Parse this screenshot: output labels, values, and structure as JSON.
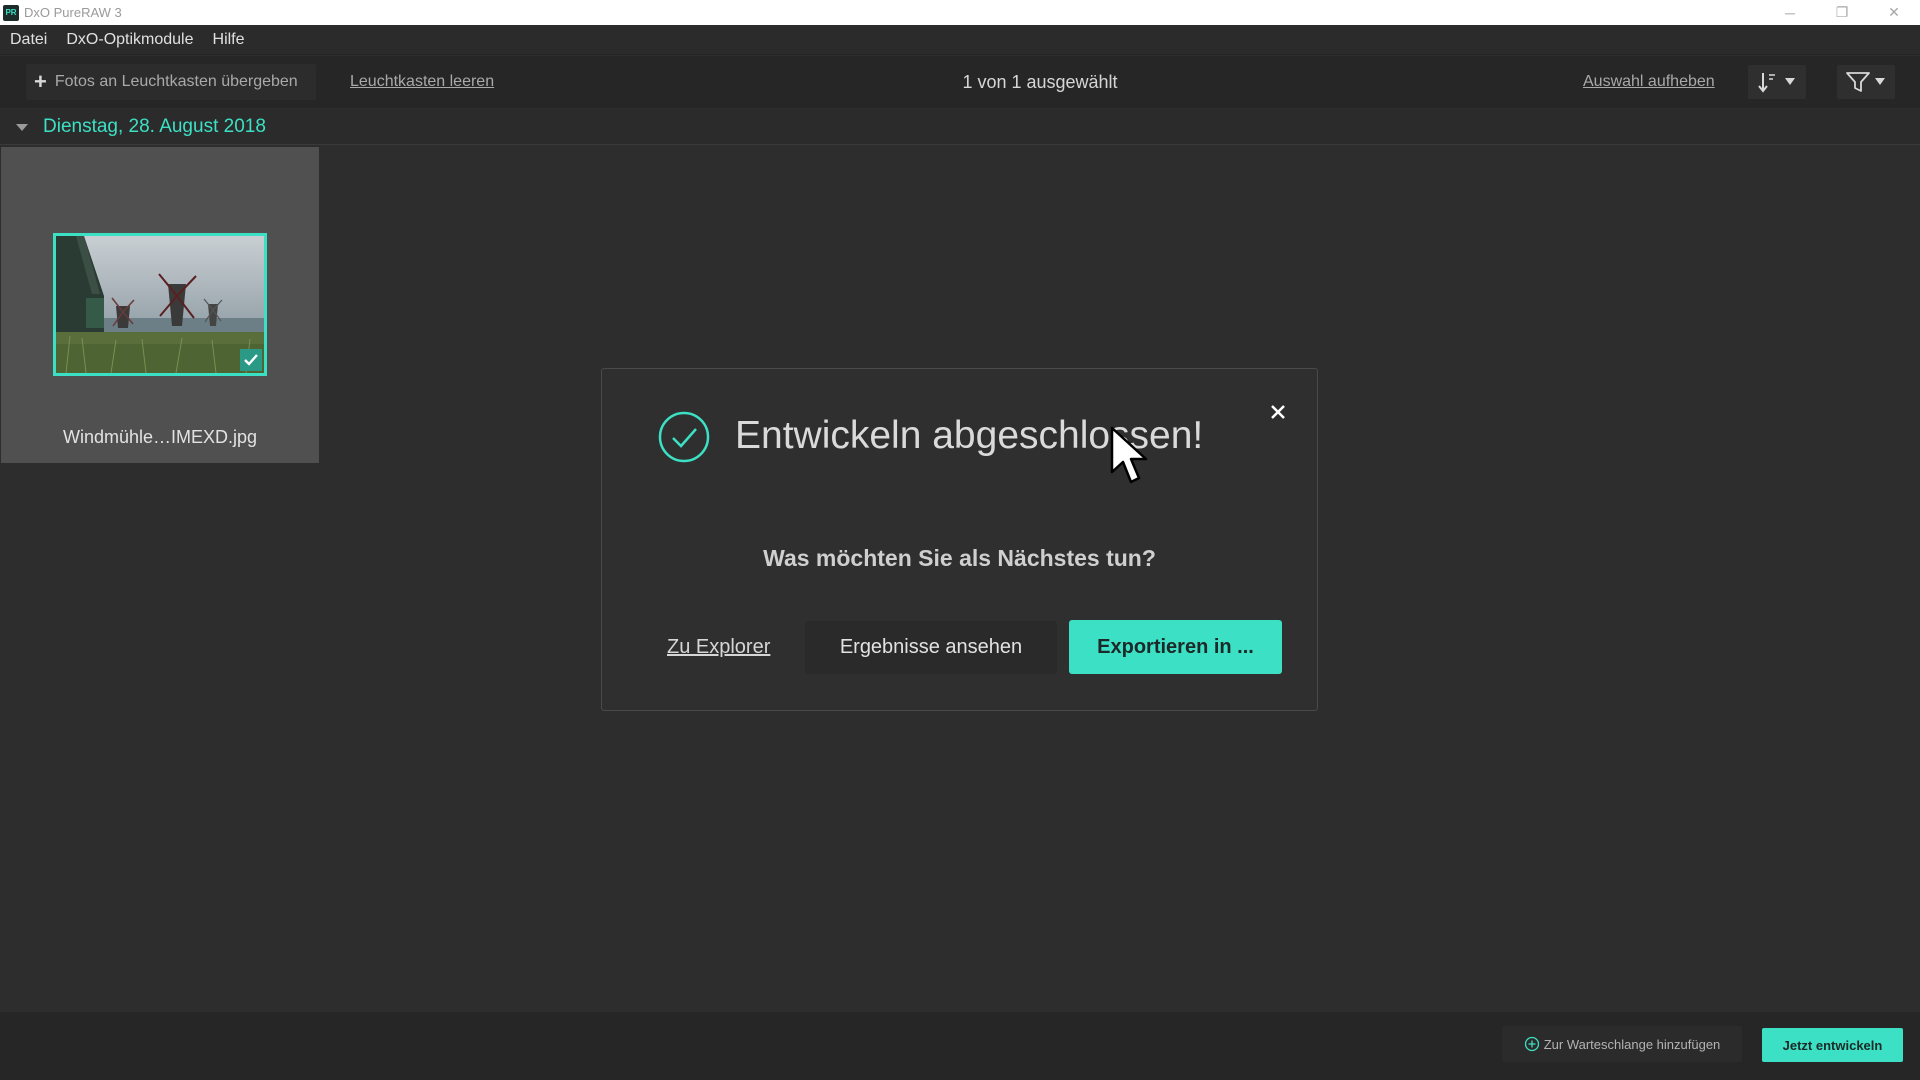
{
  "window": {
    "title": "DxO PureRAW 3",
    "app_icon_text": "PR",
    "minimize_glyph": "─",
    "restore_glyph": "❐",
    "close_glyph": "✕"
  },
  "menu": {
    "items": [
      "Datei",
      "DxO-Optikmodule",
      "Hilfe"
    ]
  },
  "toolbar": {
    "add_label": "Fotos an Leuchtkasten übergeben",
    "clear_label": "Leuchtkasten leeren",
    "selection_status": "1 von 1 ausgewählt",
    "deselect_label": "Auswahl aufheben"
  },
  "group": {
    "date": "Dienstag, 28. August 2018"
  },
  "photos": [
    {
      "filename": "Windmühle…IMEXD.jpg",
      "selected": true
    }
  ],
  "dialog": {
    "title": "Entwickeln abgeschlossen!",
    "question": "Was möchten Sie als Nächstes tun?",
    "explorer_label": "Zu Explorer",
    "results_label": "Ergebnisse ansehen",
    "export_label": "Exportieren in ..."
  },
  "bottom": {
    "queue_label": "Zur Warteschlange hinzufügen",
    "develop_label": "Jetzt entwickeln"
  },
  "colors": {
    "accent": "#3ce0c4",
    "background": "#2d2d2d",
    "toolbar": "#262626"
  }
}
